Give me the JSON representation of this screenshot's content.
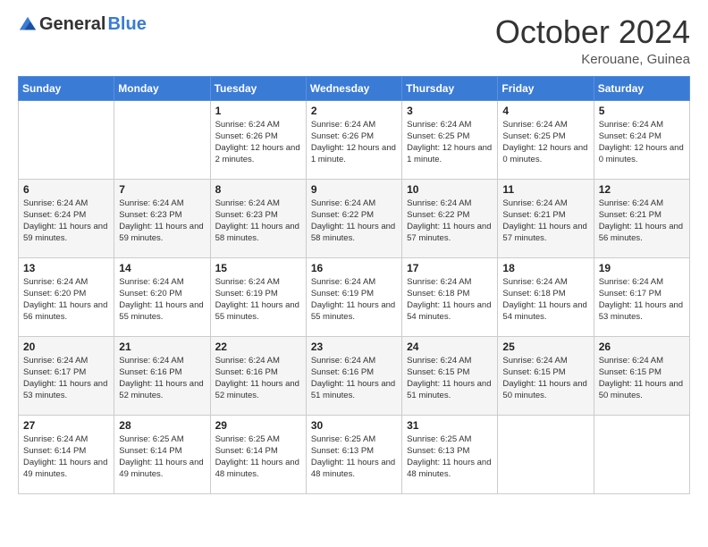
{
  "logo": {
    "general": "General",
    "blue": "Blue"
  },
  "title": "October 2024",
  "location": "Kerouane, Guinea",
  "days_of_week": [
    "Sunday",
    "Monday",
    "Tuesday",
    "Wednesday",
    "Thursday",
    "Friday",
    "Saturday"
  ],
  "weeks": [
    [
      {
        "day": "",
        "sunrise": "",
        "sunset": "",
        "daylight": ""
      },
      {
        "day": "",
        "sunrise": "",
        "sunset": "",
        "daylight": ""
      },
      {
        "day": "1",
        "sunrise": "Sunrise: 6:24 AM",
        "sunset": "Sunset: 6:26 PM",
        "daylight": "Daylight: 12 hours and 2 minutes."
      },
      {
        "day": "2",
        "sunrise": "Sunrise: 6:24 AM",
        "sunset": "Sunset: 6:26 PM",
        "daylight": "Daylight: 12 hours and 1 minute."
      },
      {
        "day": "3",
        "sunrise": "Sunrise: 6:24 AM",
        "sunset": "Sunset: 6:25 PM",
        "daylight": "Daylight: 12 hours and 1 minute."
      },
      {
        "day": "4",
        "sunrise": "Sunrise: 6:24 AM",
        "sunset": "Sunset: 6:25 PM",
        "daylight": "Daylight: 12 hours and 0 minutes."
      },
      {
        "day": "5",
        "sunrise": "Sunrise: 6:24 AM",
        "sunset": "Sunset: 6:24 PM",
        "daylight": "Daylight: 12 hours and 0 minutes."
      }
    ],
    [
      {
        "day": "6",
        "sunrise": "Sunrise: 6:24 AM",
        "sunset": "Sunset: 6:24 PM",
        "daylight": "Daylight: 11 hours and 59 minutes."
      },
      {
        "day": "7",
        "sunrise": "Sunrise: 6:24 AM",
        "sunset": "Sunset: 6:23 PM",
        "daylight": "Daylight: 11 hours and 59 minutes."
      },
      {
        "day": "8",
        "sunrise": "Sunrise: 6:24 AM",
        "sunset": "Sunset: 6:23 PM",
        "daylight": "Daylight: 11 hours and 58 minutes."
      },
      {
        "day": "9",
        "sunrise": "Sunrise: 6:24 AM",
        "sunset": "Sunset: 6:22 PM",
        "daylight": "Daylight: 11 hours and 58 minutes."
      },
      {
        "day": "10",
        "sunrise": "Sunrise: 6:24 AM",
        "sunset": "Sunset: 6:22 PM",
        "daylight": "Daylight: 11 hours and 57 minutes."
      },
      {
        "day": "11",
        "sunrise": "Sunrise: 6:24 AM",
        "sunset": "Sunset: 6:21 PM",
        "daylight": "Daylight: 11 hours and 57 minutes."
      },
      {
        "day": "12",
        "sunrise": "Sunrise: 6:24 AM",
        "sunset": "Sunset: 6:21 PM",
        "daylight": "Daylight: 11 hours and 56 minutes."
      }
    ],
    [
      {
        "day": "13",
        "sunrise": "Sunrise: 6:24 AM",
        "sunset": "Sunset: 6:20 PM",
        "daylight": "Daylight: 11 hours and 56 minutes."
      },
      {
        "day": "14",
        "sunrise": "Sunrise: 6:24 AM",
        "sunset": "Sunset: 6:20 PM",
        "daylight": "Daylight: 11 hours and 55 minutes."
      },
      {
        "day": "15",
        "sunrise": "Sunrise: 6:24 AM",
        "sunset": "Sunset: 6:19 PM",
        "daylight": "Daylight: 11 hours and 55 minutes."
      },
      {
        "day": "16",
        "sunrise": "Sunrise: 6:24 AM",
        "sunset": "Sunset: 6:19 PM",
        "daylight": "Daylight: 11 hours and 55 minutes."
      },
      {
        "day": "17",
        "sunrise": "Sunrise: 6:24 AM",
        "sunset": "Sunset: 6:18 PM",
        "daylight": "Daylight: 11 hours and 54 minutes."
      },
      {
        "day": "18",
        "sunrise": "Sunrise: 6:24 AM",
        "sunset": "Sunset: 6:18 PM",
        "daylight": "Daylight: 11 hours and 54 minutes."
      },
      {
        "day": "19",
        "sunrise": "Sunrise: 6:24 AM",
        "sunset": "Sunset: 6:17 PM",
        "daylight": "Daylight: 11 hours and 53 minutes."
      }
    ],
    [
      {
        "day": "20",
        "sunrise": "Sunrise: 6:24 AM",
        "sunset": "Sunset: 6:17 PM",
        "daylight": "Daylight: 11 hours and 53 minutes."
      },
      {
        "day": "21",
        "sunrise": "Sunrise: 6:24 AM",
        "sunset": "Sunset: 6:16 PM",
        "daylight": "Daylight: 11 hours and 52 minutes."
      },
      {
        "day": "22",
        "sunrise": "Sunrise: 6:24 AM",
        "sunset": "Sunset: 6:16 PM",
        "daylight": "Daylight: 11 hours and 52 minutes."
      },
      {
        "day": "23",
        "sunrise": "Sunrise: 6:24 AM",
        "sunset": "Sunset: 6:16 PM",
        "daylight": "Daylight: 11 hours and 51 minutes."
      },
      {
        "day": "24",
        "sunrise": "Sunrise: 6:24 AM",
        "sunset": "Sunset: 6:15 PM",
        "daylight": "Daylight: 11 hours and 51 minutes."
      },
      {
        "day": "25",
        "sunrise": "Sunrise: 6:24 AM",
        "sunset": "Sunset: 6:15 PM",
        "daylight": "Daylight: 11 hours and 50 minutes."
      },
      {
        "day": "26",
        "sunrise": "Sunrise: 6:24 AM",
        "sunset": "Sunset: 6:15 PM",
        "daylight": "Daylight: 11 hours and 50 minutes."
      }
    ],
    [
      {
        "day": "27",
        "sunrise": "Sunrise: 6:24 AM",
        "sunset": "Sunset: 6:14 PM",
        "daylight": "Daylight: 11 hours and 49 minutes."
      },
      {
        "day": "28",
        "sunrise": "Sunrise: 6:25 AM",
        "sunset": "Sunset: 6:14 PM",
        "daylight": "Daylight: 11 hours and 49 minutes."
      },
      {
        "day": "29",
        "sunrise": "Sunrise: 6:25 AM",
        "sunset": "Sunset: 6:14 PM",
        "daylight": "Daylight: 11 hours and 48 minutes."
      },
      {
        "day": "30",
        "sunrise": "Sunrise: 6:25 AM",
        "sunset": "Sunset: 6:13 PM",
        "daylight": "Daylight: 11 hours and 48 minutes."
      },
      {
        "day": "31",
        "sunrise": "Sunrise: 6:25 AM",
        "sunset": "Sunset: 6:13 PM",
        "daylight": "Daylight: 11 hours and 48 minutes."
      },
      {
        "day": "",
        "sunrise": "",
        "sunset": "",
        "daylight": ""
      },
      {
        "day": "",
        "sunrise": "",
        "sunset": "",
        "daylight": ""
      }
    ]
  ]
}
